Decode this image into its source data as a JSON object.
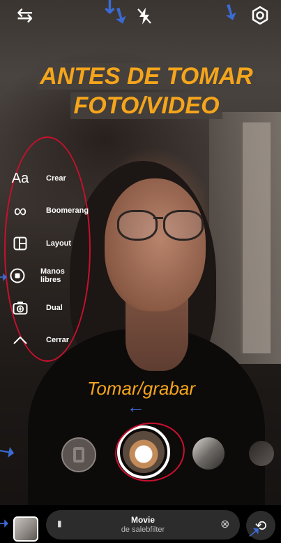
{
  "annotation": {
    "title_line1": "ANTES DE TOMAR",
    "title_line2": "FOTO/VIDEO",
    "capture_label": "Tomar/grabar"
  },
  "top_bar": {
    "swap_icon": "⇆",
    "flash_icon": "⚡",
    "settings_icon": "⚙"
  },
  "side_menu": {
    "items": [
      {
        "icon": "Aa",
        "label": "Crear"
      },
      {
        "icon": "∞",
        "label": "Boomerang"
      },
      {
        "icon": "◫",
        "label": "Layout"
      },
      {
        "icon": "◉",
        "label": "Manos libres"
      },
      {
        "icon": "⊕",
        "label": "Dual"
      },
      {
        "icon": "∧",
        "label": "Cerrar"
      }
    ]
  },
  "bottom_bar": {
    "filter_name": "Movie",
    "filter_author": "de salebfilter",
    "bookmark_icon": "▮",
    "clear_icon": "⊗",
    "flip_icon": "⟲"
  },
  "colors": {
    "annotation_orange": "#f5a51b",
    "annotation_red": "#c8102e",
    "annotation_blue": "#3b6ad2"
  }
}
